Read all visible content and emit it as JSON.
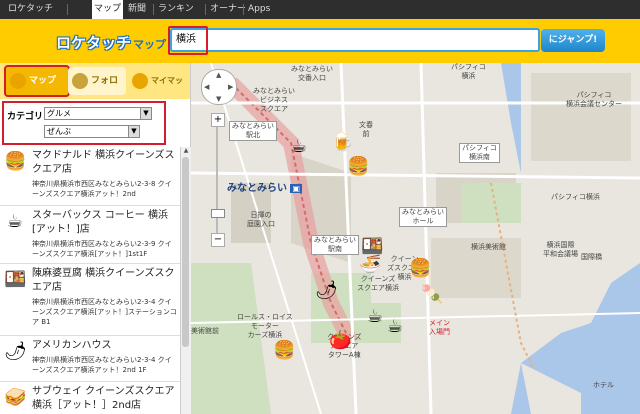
{
  "nav": {
    "tabs": [
      "ロケタッチ",
      "マップ",
      "新聞",
      "ランキング",
      "オーナーズ",
      "Apps"
    ],
    "active": 1
  },
  "header": {
    "logo": "ロケタッチ",
    "logo_sub": "マップ",
    "search_value": "横浜",
    "jump_label": "にジャンプ!"
  },
  "sidebar": {
    "modes": [
      {
        "label": "マップ",
        "icon": "map-icon"
      },
      {
        "label": "フォロー",
        "icon": "follow-icon"
      },
      {
        "label": "マイマップ",
        "icon": "smiley-icon"
      }
    ],
    "category_label": "カテゴリ",
    "category_value": "グルメ",
    "subcategory_value": "ぜんぶ",
    "items": [
      {
        "name": "マクドナルド 横浜クイーンズスクエア店",
        "address": "神奈川県横浜市西区みなとみらい2-3-8 クイーンズスクエア横浜アット！2nd",
        "icon": "burger-icon"
      },
      {
        "name": "スターバックス コーヒー 横浜[アット！]店",
        "address": "神奈川県横浜市西区みなとみらい2-3-9 クイーンズスクエア横浜[アット！]1st1F",
        "icon": "coffee-icon"
      },
      {
        "name": "陳麻婆豆腐 横浜クイーンズスクエア店",
        "address": "神奈川県横浜市西区みなとみらい2-3-4 クイーンズスクエア横浜[アット！]ステーションコア B1",
        "icon": "bento-icon"
      },
      {
        "name": "アメリカンハウス",
        "address": "神奈川県横浜市西区みなとみらい2-3-4 クイーンズスクエア横浜アット！2nd 1F",
        "icon": "pepper-icon"
      },
      {
        "name": "サブウェイ クイーンズスクエア横浜［アット！］2nd店",
        "address": "",
        "icon": "sandwich-icon"
      }
    ]
  },
  "map": {
    "labels": [
      {
        "text": "みなとみらい\n交番入口"
      },
      {
        "text": "パシフィコ\n横浜"
      },
      {
        "text": "パシフィコ\n横浜会議センター"
      },
      {
        "text": "みなとみらい\nビジネス\nスクエア"
      },
      {
        "text": "みなとみらい\n駅北"
      },
      {
        "text": "文春\n前"
      },
      {
        "text": "パシフィコ\n横浜南"
      },
      {
        "text": "パシフィコ横浜"
      },
      {
        "text": "みなとみらい"
      },
      {
        "text": "横浜美術館"
      },
      {
        "text": "みなとみらい\nホール"
      },
      {
        "text": "日揮の\n庭園入口"
      },
      {
        "text": "横浜国際\n平和会議場"
      },
      {
        "text": "国際橋"
      },
      {
        "text": "みなとみらい\n駅南"
      },
      {
        "text": "クイーン\nズスクエア\n横浜"
      },
      {
        "text": "クイーンズ\nスクエア横浜"
      },
      {
        "text": "ロールス・ロイス\nモーター\nカーズ横浜"
      },
      {
        "text": "美術館前"
      },
      {
        "text": "メイン\n入場門"
      },
      {
        "text": "クイーンズ\nスクエア\nタワーA棟"
      },
      {
        "text": "ホテル"
      }
    ]
  }
}
